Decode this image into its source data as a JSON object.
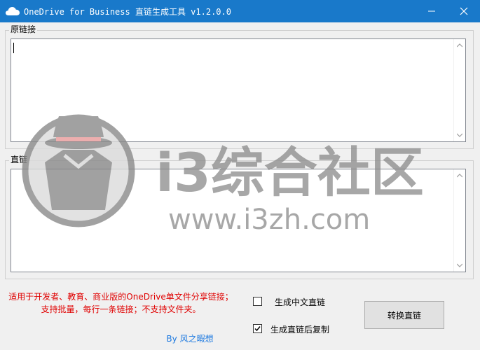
{
  "window": {
    "title": "OneDrive for Business 直链生成工具 v1.2.0.0"
  },
  "source_group": {
    "label": "原链接",
    "value": ""
  },
  "result_group": {
    "label": "直链",
    "value": ""
  },
  "notice": {
    "line1": "适用于开发者、教育、商业版的OneDrive单文件分享链接；",
    "line2": "支持批量，每行一条链接；不支持文件夹。"
  },
  "options": {
    "chinese_link": {
      "label": "生成中文直链",
      "checked": false
    },
    "copy_after": {
      "label": "生成直链后复制",
      "checked": true
    }
  },
  "convert_button": {
    "label": "转换直链"
  },
  "author": "By 风之暇想",
  "watermark": {
    "brand": "i3综合社区",
    "url": "www.i3zh.com"
  },
  "icons": {
    "app": "onedrive-cloud-icon",
    "minimize": "minimize-icon",
    "close": "close-icon",
    "scroll_up": "chevron-up-icon",
    "scroll_down": "chevron-down-icon",
    "check": "check-icon",
    "watermark_logo": "spy-hat-logo"
  },
  "colors": {
    "titlebar": "#1979ca",
    "notice": "#e00000",
    "author": "#1e7ae0"
  }
}
